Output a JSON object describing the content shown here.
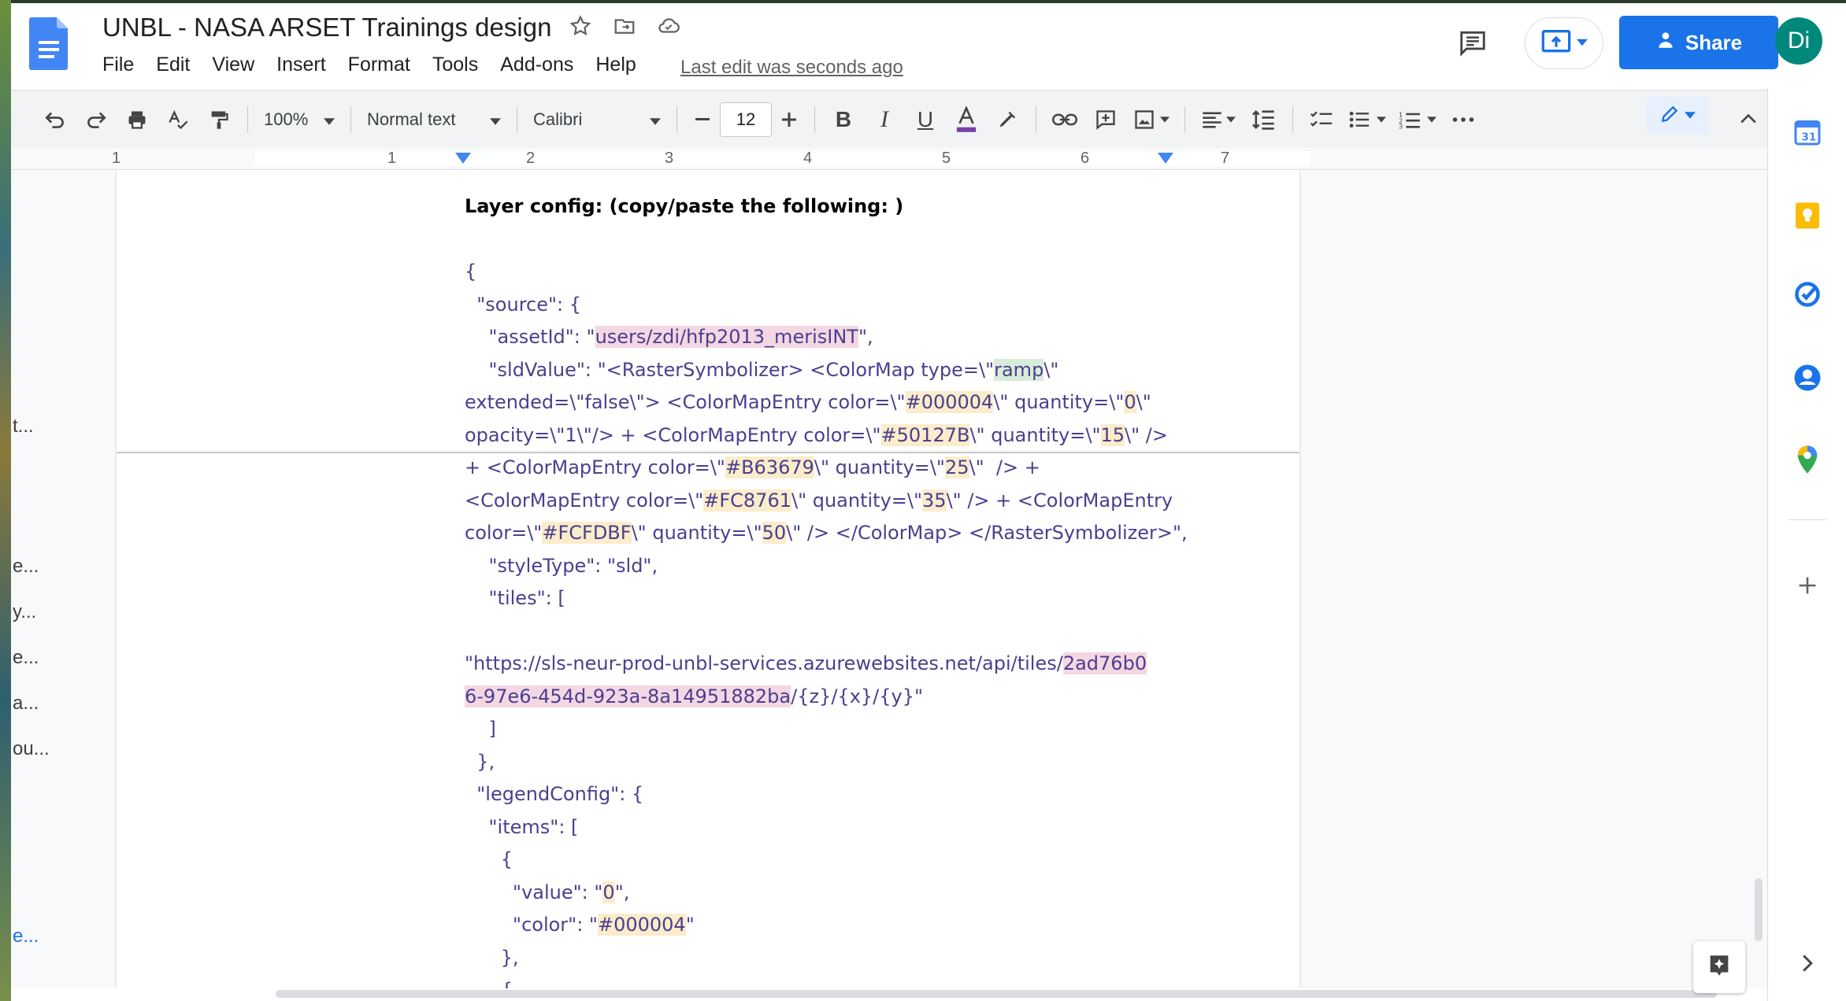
{
  "document": {
    "title": "UNBL - NASA ARSET Trainings design",
    "last_edit": "Last edit was seconds ago"
  },
  "menu": [
    "File",
    "Edit",
    "View",
    "Insert",
    "Format",
    "Tools",
    "Add-ons",
    "Help"
  ],
  "header": {
    "share_label": "Share",
    "avatar_initials": "Di"
  },
  "toolbar": {
    "zoom": "100%",
    "style": "Normal text",
    "font": "Calibri",
    "font_size": "12"
  },
  "ruler": {
    "numbers": [
      "1",
      "1",
      "2",
      "3",
      "4",
      "5",
      "6",
      "7"
    ]
  },
  "outline": {
    "items": [
      "t...",
      "e...",
      "y...",
      "e...",
      "a...",
      "ou...",
      "e..."
    ]
  },
  "content": {
    "lines": [
      [
        {
          "t": "Layer config: (copy/paste the following: )"
        }
      ],
      [
        {
          "t": " "
        }
      ],
      [
        {
          "t": "{"
        }
      ],
      [
        {
          "t": "  \"source\": {"
        }
      ],
      [
        {
          "t": "    \"assetId\": \""
        },
        {
          "t": "users/zdi/hfp2013_merisINT",
          "h": "pink"
        },
        {
          "t": "\","
        }
      ],
      [
        {
          "t": "    \"sldValue\": \"<RasterSymbolizer> <ColorMap type=\\\""
        },
        {
          "t": "ramp",
          "h": "green"
        },
        {
          "t": "\\\""
        }
      ],
      [
        {
          "t": "extended=\\\"false\\\"> <ColorMapEntry color=\\\""
        },
        {
          "t": "#000004",
          "h": "yellow"
        },
        {
          "t": "\\\" quantity=\\\""
        },
        {
          "t": "0",
          "h": "yellow"
        },
        {
          "t": "\\\""
        }
      ],
      [
        {
          "t": "opacity=\\\"1\\\"/> + <ColorMapEntry color=\\\""
        },
        {
          "t": "#50127B",
          "h": "yellow"
        },
        {
          "t": "\\\" quantity=\\\""
        },
        {
          "t": "15",
          "h": "yellow"
        },
        {
          "t": "\\\" />"
        }
      ],
      [
        {
          "t": "+ <ColorMapEntry color=\\\""
        },
        {
          "t": "#B63679",
          "h": "yellow"
        },
        {
          "t": "\\\" quantity=\\\""
        },
        {
          "t": "25",
          "h": "yellow"
        },
        {
          "t": "\\\"  /> +"
        }
      ],
      [
        {
          "t": "<ColorMapEntry color=\\\""
        },
        {
          "t": "#FC8761",
          "h": "yellow"
        },
        {
          "t": "\\\" quantity=\\\""
        },
        {
          "t": "35",
          "h": "yellow"
        },
        {
          "t": "\\\" /> + <ColorMapEntry"
        }
      ],
      [
        {
          "t": "color=\\\""
        },
        {
          "t": "#FCFDBF",
          "h": "yellow"
        },
        {
          "t": "\\\" quantity=\\\""
        },
        {
          "t": "50",
          "h": "yellow"
        },
        {
          "t": "\\\" /> </ColorMap> </RasterSymbolizer>\","
        }
      ],
      [
        {
          "t": "    \"styleType\": \"sld\","
        }
      ],
      [
        {
          "t": "    \"tiles\": ["
        }
      ],
      [
        {
          "t": " "
        }
      ],
      [
        {
          "t": "\"https://sls-neur-prod-unbl-services.azurewebsites.net/api/tiles/"
        },
        {
          "t": "2ad76b0",
          "h": "pink"
        }
      ],
      [
        {
          "t": "6-97e6-454d-923a-8a14951882ba",
          "h": "pink"
        },
        {
          "t": "/{z}/{x}/{y}\""
        }
      ],
      [
        {
          "t": "    ]"
        }
      ],
      [
        {
          "t": "  },"
        }
      ],
      [
        {
          "t": "  \"legendConfig\": {"
        }
      ],
      [
        {
          "t": "    \"items\": ["
        }
      ],
      [
        {
          "t": "      {"
        }
      ],
      [
        {
          "t": "        \"value\": \""
        },
        {
          "t": "0",
          "h": "yellow"
        },
        {
          "t": "\","
        }
      ],
      [
        {
          "t": "        \"color\": \""
        },
        {
          "t": "#000004",
          "h": "yellow"
        },
        {
          "t": "\""
        }
      ],
      [
        {
          "t": "      },"
        }
      ],
      [
        {
          "t": "      {"
        }
      ]
    ]
  },
  "colors": {
    "accent": "#1a73e8",
    "text": "#4b3f8f",
    "highlight_pink": "#f3d7e3",
    "highlight_yellow": "#fbeccb",
    "highlight_green": "#d8ecd9"
  },
  "side_panel": {
    "icons": [
      "calendar-icon",
      "keep-icon",
      "tasks-icon",
      "contacts-icon",
      "maps-icon",
      "add-icon",
      "expand-icon"
    ]
  }
}
